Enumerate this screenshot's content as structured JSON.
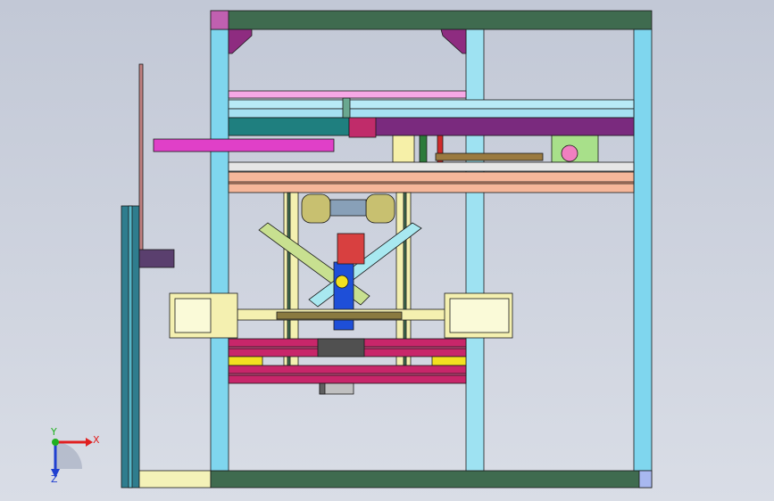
{
  "viewport": {
    "background_top": "#c2c8d6",
    "background_bottom": "#d9dde6"
  },
  "colors": {
    "frame_cyan": "#7fd6ee",
    "frame_green": "#3f6b4f",
    "magenta": "#d52fa0",
    "pink": "#f080d0",
    "purple": "#7a2a7e",
    "orange": "#f6b79a",
    "yellow": "#f2f0a0",
    "olive": "#9a9060",
    "blue": "#1e4fd8",
    "crimson": "#c8266a"
  },
  "triad": {
    "x_label": "X",
    "y_label": "Y",
    "z_label": "Z",
    "x_color": "#e02020",
    "y_color": "#20b020",
    "z_color": "#2040d0"
  }
}
